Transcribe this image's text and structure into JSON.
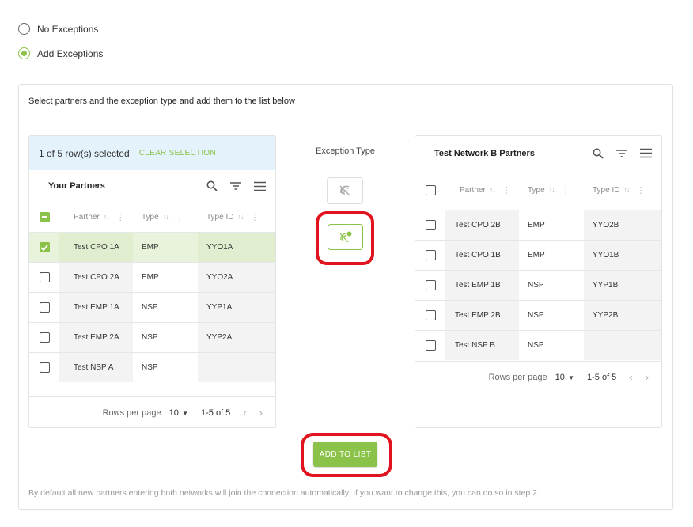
{
  "radios": [
    {
      "label": "No Exceptions",
      "selected": false
    },
    {
      "label": "Add Exceptions",
      "selected": true
    }
  ],
  "panel": {
    "instruction": "Select partners and the exception type and add them to the list below"
  },
  "your_partners": {
    "selection_text": "1 of 5 row(s) selected",
    "clear_selection": "CLEAR SELECTION",
    "title": "Your Partners",
    "columns": [
      "Partner",
      "Type",
      "Type ID"
    ],
    "rows": [
      {
        "partner": "Test CPO 1A",
        "type": "EMP",
        "type_id": "YYO1A",
        "checked": true
      },
      {
        "partner": "Test CPO 2A",
        "type": "EMP",
        "type_id": "YYO2A",
        "checked": false
      },
      {
        "partner": "Test EMP 1A",
        "type": "NSP",
        "type_id": "YYP1A",
        "checked": false
      },
      {
        "partner": "Test EMP 2A",
        "type": "NSP",
        "type_id": "YYP2A",
        "checked": false
      },
      {
        "partner": "Test NSP A",
        "type": "NSP",
        "type_id": "",
        "checked": false
      }
    ],
    "pager": {
      "rows_per_page_label": "Rows per page",
      "rows_per_page": "10",
      "range": "1-5 of 5"
    }
  },
  "exception_type": {
    "title": "Exception Type",
    "options": [
      {
        "icon": "crossed-out-signal-icon",
        "selected": false
      },
      {
        "icon": "crossed-out-signal-add-icon",
        "selected": true
      }
    ]
  },
  "network_b_partners": {
    "title": "Test Network B Partners",
    "columns": [
      "Partner",
      "Type",
      "Type ID"
    ],
    "rows": [
      {
        "partner": "Test CPO 2B",
        "type": "EMP",
        "type_id": "YYO2B",
        "checked": false
      },
      {
        "partner": "Test CPO 1B",
        "type": "EMP",
        "type_id": "YYO1B",
        "checked": false
      },
      {
        "partner": "Test EMP 1B",
        "type": "NSP",
        "type_id": "YYP1B",
        "checked": false
      },
      {
        "partner": "Test EMP 2B",
        "type": "NSP",
        "type_id": "YYP2B",
        "checked": false
      },
      {
        "partner": "Test NSP B",
        "type": "NSP",
        "type_id": "",
        "checked": false
      }
    ],
    "pager": {
      "rows_per_page_label": "Rows per page",
      "rows_per_page": "10",
      "range": "1-5 of 5"
    }
  },
  "add_button": "ADD TO LIST",
  "footer_note": "By default all new partners entering both networks will join the connection automatically. If you want to change this, you can do so in step 2.",
  "colors": {
    "accent": "#8bc34a",
    "highlight": "#e0141e",
    "selection_bar": "#e3f2fb"
  }
}
